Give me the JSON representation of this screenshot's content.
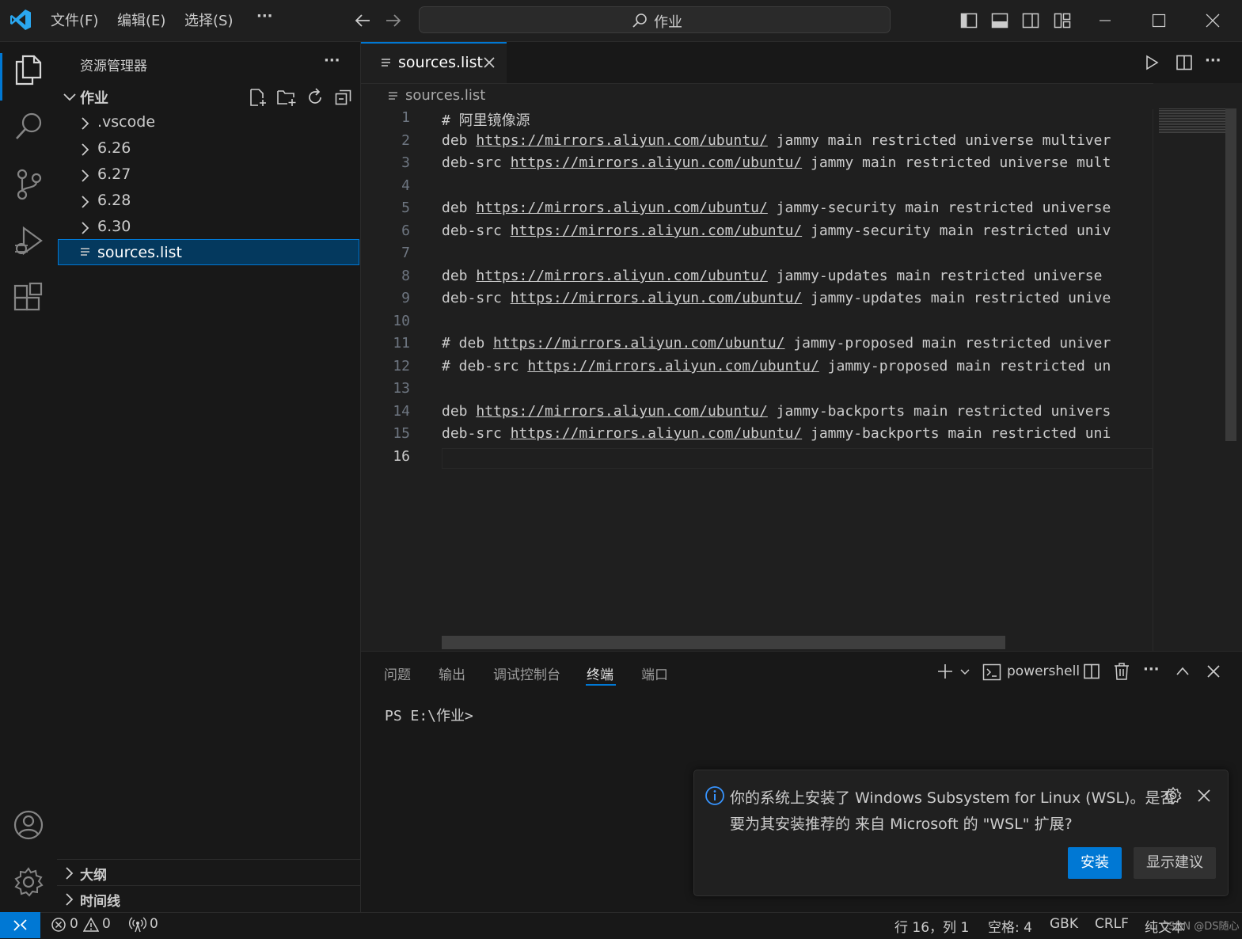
{
  "titlebar": {
    "menus": [
      "文件(F)",
      "编辑(E)",
      "选择(S)"
    ],
    "more": "···",
    "search": "作业"
  },
  "explorer": {
    "title": "资源管理器",
    "more": "···",
    "root": "作业",
    "items": [
      ".vscode",
      "6.26",
      "6.27",
      "6.28",
      "6.30",
      "sources.list"
    ],
    "selected": "sources.list",
    "outline": "大纲",
    "timeline": "时间线"
  },
  "editor": {
    "tab": "sources.list",
    "breadcrumb": "sources.list",
    "current_line": 16,
    "lines": [
      {
        "n": "1",
        "pre": "# 阿里镜像源",
        "url": "",
        "post": ""
      },
      {
        "n": "2",
        "pre": "deb ",
        "url": "https://mirrors.aliyun.com/ubuntu/",
        "post": " jammy main restricted universe multiver"
      },
      {
        "n": "3",
        "pre": "deb-src ",
        "url": "https://mirrors.aliyun.com/ubuntu/",
        "post": " jammy main restricted universe mult"
      },
      {
        "n": "4",
        "pre": "",
        "url": "",
        "post": ""
      },
      {
        "n": "5",
        "pre": "deb ",
        "url": "https://mirrors.aliyun.com/ubuntu/",
        "post": " jammy-security main restricted universe"
      },
      {
        "n": "6",
        "pre": "deb-src ",
        "url": "https://mirrors.aliyun.com/ubuntu/",
        "post": " jammy-security main restricted univ"
      },
      {
        "n": "7",
        "pre": "",
        "url": "",
        "post": ""
      },
      {
        "n": "8",
        "pre": "deb ",
        "url": "https://mirrors.aliyun.com/ubuntu/",
        "post": " jammy-updates main restricted universe"
      },
      {
        "n": "9",
        "pre": "deb-src ",
        "url": "https://mirrors.aliyun.com/ubuntu/",
        "post": " jammy-updates main restricted unive"
      },
      {
        "n": "10",
        "pre": "",
        "url": "",
        "post": ""
      },
      {
        "n": "11",
        "pre": "# deb ",
        "url": "https://mirrors.aliyun.com/ubuntu/",
        "post": " jammy-proposed main restricted univer"
      },
      {
        "n": "12",
        "pre": "# deb-src ",
        "url": "https://mirrors.aliyun.com/ubuntu/",
        "post": " jammy-proposed main restricted un"
      },
      {
        "n": "13",
        "pre": "",
        "url": "",
        "post": ""
      },
      {
        "n": "14",
        "pre": "deb ",
        "url": "https://mirrors.aliyun.com/ubuntu/",
        "post": " jammy-backports main restricted univers"
      },
      {
        "n": "15",
        "pre": "deb-src ",
        "url": "https://mirrors.aliyun.com/ubuntu/",
        "post": " jammy-backports main restricted uni"
      },
      {
        "n": "16",
        "pre": "",
        "url": "",
        "post": ""
      }
    ]
  },
  "panel": {
    "tabs": [
      "问题",
      "输出",
      "调试控制台",
      "终端",
      "端口"
    ],
    "active_tab": "终端",
    "shell": "powershell",
    "prompt": "PS E:\\作业>"
  },
  "notification": {
    "line1": "你的系统上安装了 Windows Subsystem for Linux (WSL)。是否",
    "line2": "要为其安装推荐的 来自 Microsoft 的 \"WSL\" 扩展?",
    "install": "安装",
    "suggest": "显示建议"
  },
  "statusbar": {
    "errors": "0",
    "warnings": "0",
    "ports": "0",
    "position": "行 16，列 1",
    "spaces": "空格: 4",
    "encoding": "GBK",
    "eol": "CRLF",
    "language": "纯文本",
    "watermark": "CSDN @DS随心"
  },
  "colors": {
    "accent": "#0078d4",
    "selection": "#04395e",
    "background": "#1f1f1f",
    "sidebar": "#181818"
  }
}
